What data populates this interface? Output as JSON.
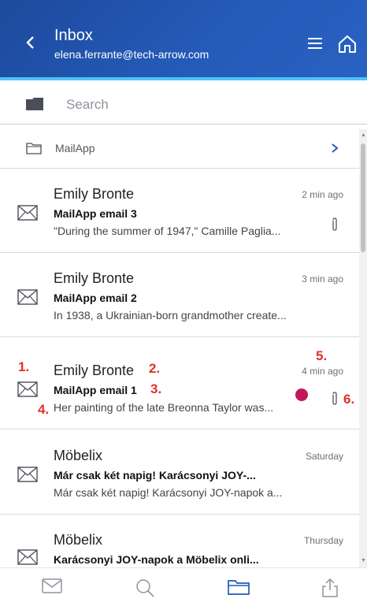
{
  "header": {
    "title": "Inbox",
    "account": "elena.ferrante@tech-arrow.com",
    "back_icon": "chevron-left-icon",
    "menu_icon": "hamburger-menu-icon",
    "home_icon": "home-icon",
    "background": "#245ab8",
    "accent": "#4fc3f7"
  },
  "search": {
    "placeholder": "Search",
    "value": ""
  },
  "folder": {
    "label": "MailApp"
  },
  "emails": [
    {
      "sender": "Emily Bronte",
      "time": "2 min ago",
      "subject": "MailApp email 3",
      "preview": "\"During the summer of 1947,\" Camille Paglia...",
      "has_attachment": true,
      "unread": false
    },
    {
      "sender": "Emily Bronte",
      "time": "3 min ago",
      "subject": "MailApp email 2",
      "preview": "In 1938, a Ukrainian-born grandmother create...",
      "has_attachment": false,
      "unread": false
    },
    {
      "sender": "Emily Bronte",
      "time": "4 min ago",
      "subject": "MailApp email 1",
      "preview": "Her painting of the late Breonna Taylor was...",
      "has_attachment": true,
      "unread": true
    },
    {
      "sender": "Möbelix",
      "time": "Saturday",
      "subject": "Már csak két napig! Karácsonyi JOY-...",
      "preview": "Már csak két napig! Karácsonyi JOY-napok a...",
      "has_attachment": false,
      "unread": false
    },
    {
      "sender": "Möbelix",
      "time": "Thursday",
      "subject": "Karácsonyi JOY-napok a Möbelix onli...",
      "preview": "",
      "has_attachment": false,
      "unread": false
    }
  ],
  "annotations": {
    "a1": "1.",
    "a2": "2.",
    "a3": "3.",
    "a4": "4.",
    "a5": "5.",
    "a6": "6."
  },
  "bottom_nav": [
    {
      "icon": "mail-icon"
    },
    {
      "icon": "search-icon"
    },
    {
      "icon": "folder-icon",
      "active": true
    },
    {
      "icon": "share-icon"
    }
  ],
  "colors": {
    "unread_dot": "#c2185b",
    "annotation": "#e0312c",
    "active_nav": "#245ab8"
  }
}
